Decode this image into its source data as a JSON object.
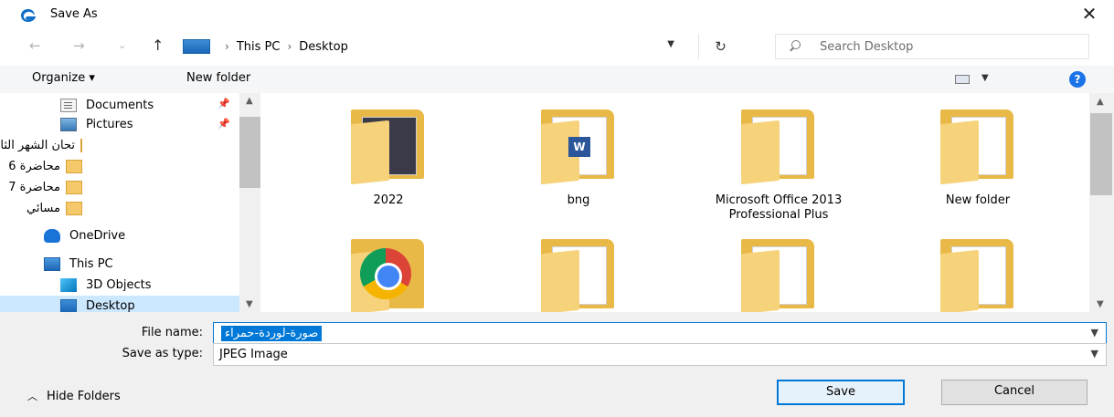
{
  "window": {
    "title": "Save As",
    "close_glyph": "✕"
  },
  "nav": {
    "back_glyph": "←",
    "forward_glyph": "→",
    "recent_glyph": "⌄",
    "up_glyph": "↑",
    "refresh_glyph": "↻"
  },
  "address": {
    "crumbs": [
      "This PC",
      "Desktop"
    ],
    "sep": "›"
  },
  "search": {
    "placeholder": "Search Desktop"
  },
  "toolbar": {
    "organize_label": "Organize ▾",
    "new_folder_label": "New folder",
    "help_glyph": "?"
  },
  "sidebar": {
    "items": [
      {
        "label": "Documents",
        "pinned": true
      },
      {
        "label": "Pictures",
        "pinned": true
      },
      {
        "label": "تحان الشهر الثاني"
      },
      {
        "label": "محاضرة 6"
      },
      {
        "label": "محاضرة 7"
      },
      {
        "label": "مسائي"
      },
      {
        "label": "OneDrive"
      },
      {
        "label": "This PC"
      },
      {
        "label": "3D Objects"
      },
      {
        "label": "Desktop"
      }
    ],
    "pin_glyph": "📌"
  },
  "files": {
    "items": [
      {
        "label": "2022"
      },
      {
        "label": "bng"
      },
      {
        "label": "Microsoft Office 2013 Professional Plus"
      },
      {
        "label": "New folder"
      },
      {
        "label": ""
      },
      {
        "label": ""
      },
      {
        "label": ""
      },
      {
        "label": ""
      }
    ],
    "word_badge": "W"
  },
  "form": {
    "file_name_label": "File name:",
    "file_name_value": "صورة-لوردة-حمراء",
    "save_type_label": "Save as type:",
    "save_type_value": "JPEG Image"
  },
  "footer": {
    "hide_folders_label": "Hide Folders",
    "save_label": "Save",
    "cancel_label": "Cancel"
  }
}
